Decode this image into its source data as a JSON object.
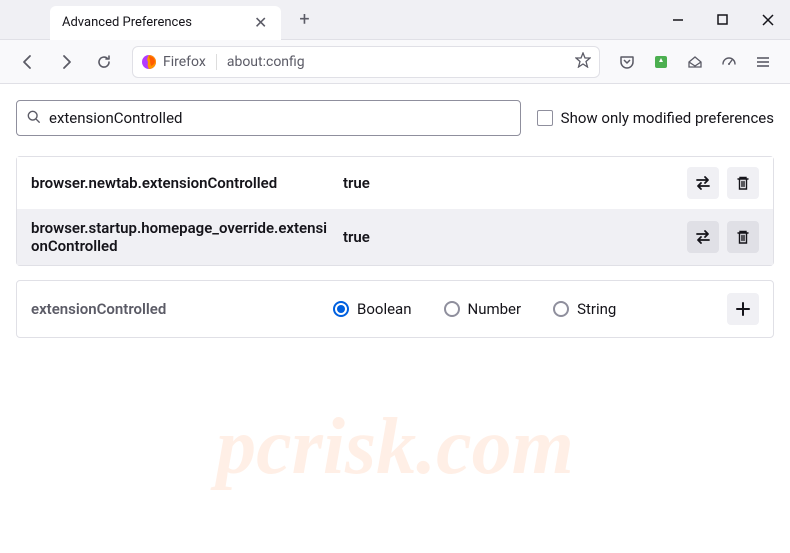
{
  "tab": {
    "title": "Advanced Preferences"
  },
  "addressbar": {
    "identity": "Firefox",
    "url": "about:config"
  },
  "search": {
    "value": "extensionControlled",
    "checkbox_label": "Show only modified preferences"
  },
  "prefs": [
    {
      "name": "browser.newtab.extensionControlled",
      "value": "true"
    },
    {
      "name": "browser.startup.homepage_override.extensionControlled",
      "value": "true"
    }
  ],
  "new_pref": {
    "name": "extensionControlled",
    "types": [
      "Boolean",
      "Number",
      "String"
    ],
    "selected": 0
  },
  "watermark": "pcrisk.com"
}
